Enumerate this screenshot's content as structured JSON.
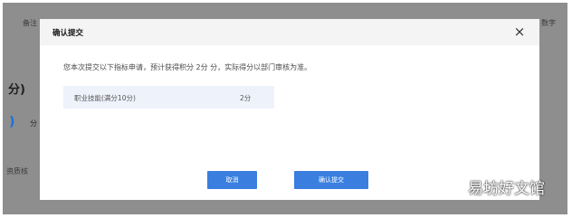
{
  "background": {
    "top_left_label": "备注",
    "top_right_label": "数字",
    "heading_fragment": "分)",
    "ring_glyph": ")",
    "unit_fragment": "分",
    "side_label": "资质核"
  },
  "dialog": {
    "title": "确认提交",
    "close_icon": "×",
    "message": "您本次提交以下指标申请，预计获得积分 2分 分，实际得分以部门审核为准。",
    "summary": {
      "label": "职业技能(满分10分)",
      "value": "2分"
    },
    "buttons": {
      "cancel": "取消",
      "confirm": "确认提交"
    },
    "accent_color": "#3a7fe0"
  },
  "watermark": "易坊好文馆"
}
